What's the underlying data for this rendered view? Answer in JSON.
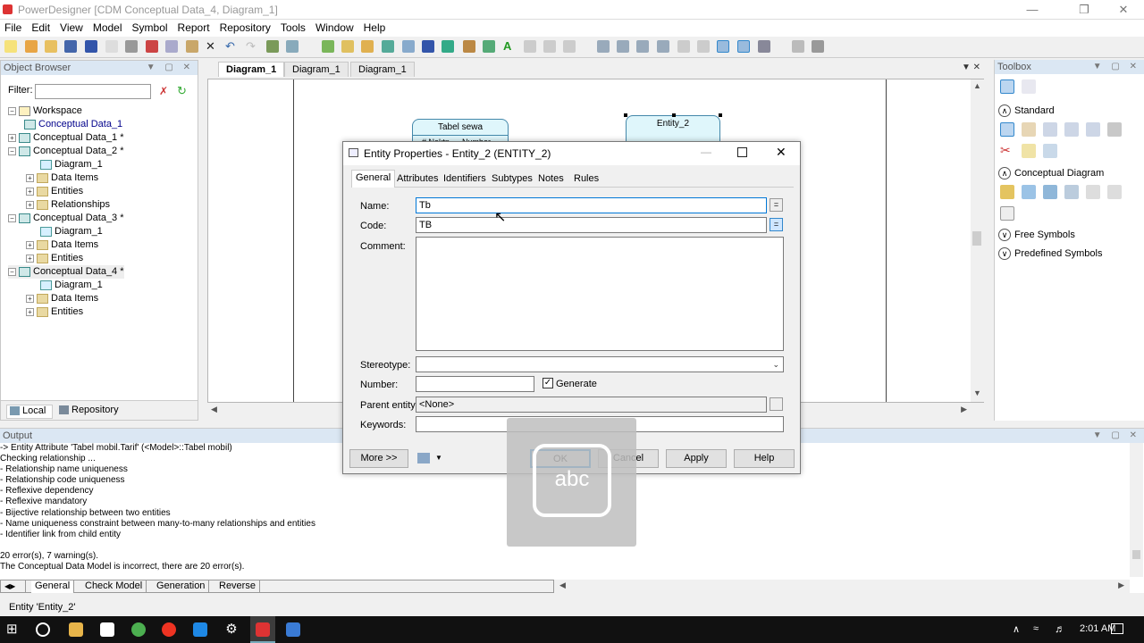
{
  "window": {
    "title": "PowerDesigner [CDM Conceptual Data_4, Diagram_1]"
  },
  "menu": [
    "File",
    "Edit",
    "View",
    "Model",
    "Symbol",
    "Report",
    "Repository",
    "Tools",
    "Window",
    "Help"
  ],
  "object_browser": {
    "title": "Object Browser",
    "filter_label": "Filter:",
    "tree": [
      {
        "label": "Workspace",
        "level": 0
      },
      {
        "label": "Conceptual Data_1",
        "level": 1
      },
      {
        "label": "Conceptual Data_1 *",
        "level": 1
      },
      {
        "label": "Conceptual Data_2 *",
        "level": 1
      },
      {
        "label": "Diagram_1",
        "level": 2
      },
      {
        "label": "Data Items",
        "level": 2
      },
      {
        "label": "Entities",
        "level": 2
      },
      {
        "label": "Relationships",
        "level": 2
      },
      {
        "label": "Conceptual Data_3 *",
        "level": 1
      },
      {
        "label": "Diagram_1",
        "level": 2
      },
      {
        "label": "Data Items",
        "level": 2
      },
      {
        "label": "Entities",
        "level": 2
      },
      {
        "label": "Conceptual Data_4 *",
        "level": 1
      },
      {
        "label": "Diagram_1",
        "level": 2
      },
      {
        "label": "Data Items",
        "level": 2
      },
      {
        "label": "Entities",
        "level": 2
      }
    ],
    "bottom_tabs": [
      "Local",
      "Repository"
    ]
  },
  "diagram": {
    "tabs": [
      "Diagram_1",
      "Diagram_1",
      "Diagram_1"
    ],
    "entities": [
      {
        "name": "Tabel sewa",
        "attr": "#  Noktp",
        "type": "Number"
      },
      {
        "name": "Entity_2"
      }
    ]
  },
  "toolbox": {
    "title": "Toolbox",
    "sections": [
      "Standard",
      "Conceptual Diagram",
      "Free Symbols",
      "Predefined Symbols"
    ]
  },
  "dialog": {
    "title": "Entity Properties - Entity_2 (ENTITY_2)",
    "tabs": [
      "General",
      "Attributes",
      "Identifiers",
      "Subtypes",
      "Notes",
      "Rules"
    ],
    "labels": {
      "name": "Name:",
      "code": "Code:",
      "comment": "Comment:",
      "stereotype": "Stereotype:",
      "number": "Number:",
      "parent": "Parent entity:",
      "keywords": "Keywords:"
    },
    "values": {
      "name": "Tb",
      "code": "TB",
      "parent": "<None>",
      "generate": "Generate"
    },
    "buttons": {
      "more": "More >>",
      "ok": "OK",
      "cancel": "Cancel",
      "apply": "Apply",
      "help": "Help"
    },
    "eq": "="
  },
  "overlay": {
    "text": "abc"
  },
  "output": {
    "title": "Output",
    "lines": [
      "            -> Entity Attribute 'Tabel mobil.Tarif'      (<Model>::Tabel mobil)",
      "Checking relationship ...",
      "-    Relationship name uniqueness",
      "-    Relationship code uniqueness",
      "-    Reflexive dependency",
      "-    Reflexive mandatory",
      "-    Bijective relationship between two entities",
      "-    Name uniqueness constraint between many-to-many relationships and entities",
      "-    Identifier link from child entity",
      "",
      "20 error(s),  7 warning(s).",
      "The Conceptual Data Model is incorrect, there are 20 error(s)."
    ],
    "tabs": [
      "General",
      "Check Model",
      "Generation",
      "Reverse"
    ]
  },
  "status": {
    "text": "Entity 'Entity_2'"
  },
  "taskbar": {
    "time": "2:01 AM"
  }
}
